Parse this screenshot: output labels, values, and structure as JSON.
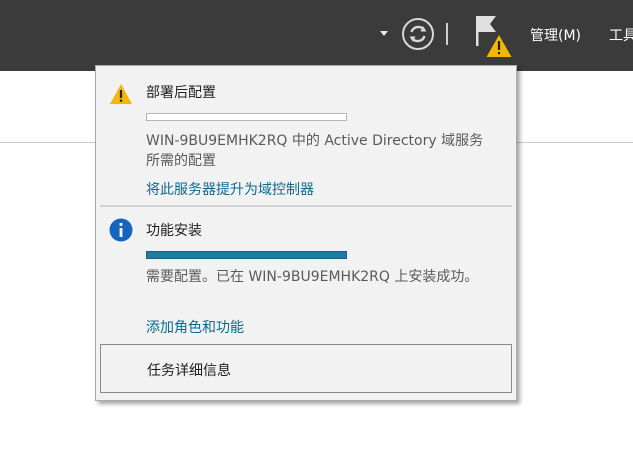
{
  "toolbar": {
    "manage_label": "管理(M)",
    "tools_label": "工具",
    "refresh_icon": "refresh-icon",
    "flag_icon": "notification-flag-warning-icon"
  },
  "popup": {
    "notifications": [
      {
        "icon": "warning-icon",
        "title": "部署后配置",
        "progress": 0,
        "message": "WIN-9BU9EMHK2RQ 中的 Active Directory 域服务 所需的配置",
        "link": "将此服务器提升为域控制器"
      },
      {
        "icon": "info-icon",
        "title": "功能安装",
        "progress": 1.0,
        "message": "需要配置。已在 WIN-9BU9EMHK2RQ 上安装成功。",
        "link": "添加角色和功能"
      }
    ],
    "task_details_label": "任务详细信息"
  },
  "colors": {
    "toolbar_bg": "#3b3b3b",
    "link": "#0b6a8e",
    "progress_fill": "#1f7ca3",
    "warning": "#f5b800",
    "info": "#1565c0"
  }
}
